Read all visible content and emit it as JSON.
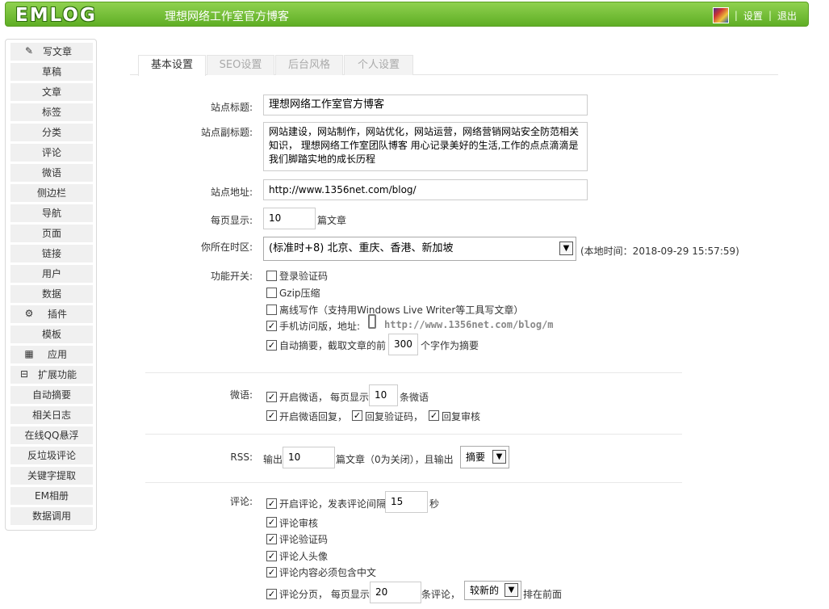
{
  "header": {
    "logo": "EMLOG",
    "site_title": "理想网络工作室官方博客",
    "settings_link": "设置",
    "logout_link": "退出",
    "sep": "|"
  },
  "sidebar": {
    "items": [
      {
        "label": "写文章",
        "icon": "pencil-icon"
      },
      {
        "label": "草稿"
      },
      {
        "label": "文章"
      },
      {
        "label": "标签"
      },
      {
        "label": "分类"
      },
      {
        "label": "评论"
      },
      {
        "label": "微语"
      },
      {
        "label": "侧边栏"
      },
      {
        "label": "导航"
      },
      {
        "label": "页面"
      },
      {
        "label": "链接"
      },
      {
        "label": "用户"
      },
      {
        "label": "数据"
      },
      {
        "label": "插件",
        "icon": "plugin-icon"
      },
      {
        "label": "模板"
      },
      {
        "label": "应用",
        "icon": "app-icon"
      },
      {
        "label": "扩展功能",
        "icon": "collapse-icon"
      },
      {
        "label": "自动摘要"
      },
      {
        "label": "相关日志"
      },
      {
        "label": "在线QQ悬浮"
      },
      {
        "label": "反垃圾评论"
      },
      {
        "label": "关键字提取"
      },
      {
        "label": "EM相册"
      },
      {
        "label": "数据调用"
      }
    ]
  },
  "tabs": [
    "基本设置",
    "SEO设置",
    "后台风格",
    "个人设置"
  ],
  "form": {
    "site_title_label": "站点标题:",
    "site_title_value": "理想网络工作室官方博客",
    "subtitle_label": "站点副标题:",
    "subtitle_value": "网站建设，网站制作，网站优化，网站运营，网络营销网站安全防范相关知识， 理想网络工作室团队博客    用心记录美好的生活,工作的点点滴滴是我们脚踏实地的成长历程",
    "url_label": "站点地址:",
    "url_value": "http://www.1356net.com/blog/",
    "per_page_label": "每页显示:",
    "per_page_value": "10",
    "per_page_unit": "篇文章",
    "timezone_label": "你所在时区:",
    "timezone_value": "(标准时+8) 北京、重庆、香港、新加坡",
    "local_time": "(本地时间：2018-09-29 15:57:59)",
    "features_label": "功能开关:",
    "login_captcha": "登录验证码",
    "gzip": "Gzip压缩",
    "offline_write": "离线写作（支持用Windows Live Writer等工具写文章）",
    "mobile": "手机访问版，地址:",
    "mobile_url": "http://www.1356net.com/blog/m",
    "auto_excerpt_pre": "自动摘要，截取文章的前",
    "auto_excerpt_value": "300",
    "auto_excerpt_post": "个字作为摘要",
    "twitter_label": "微语:",
    "twitter_enable": "开启微语，",
    "twitter_per_page_pre": "每页显示",
    "twitter_per_page_value": "10",
    "twitter_per_page_post": "条微语",
    "twitter_reply": "开启微语回复，",
    "twitter_reply_captcha": "回复验证码，",
    "twitter_reply_audit": "回复审核",
    "rss_label": "RSS:",
    "rss_pre": "输出",
    "rss_value": "10",
    "rss_mid": "篇文章（0为关闭），且输出",
    "rss_select": "摘要",
    "comment_label": "评论:",
    "comment_enable": "开启评论，发表评论间隔",
    "comment_interval": "15",
    "comment_interval_unit": "秒",
    "comment_audit": "评论审核",
    "comment_captcha": "评论验证码",
    "comment_avatar": "评论人头像",
    "comment_chinese": "评论内容必须包含中文",
    "comment_paging_pre": "评论分页，  每页显示",
    "comment_paging_value": "20",
    "comment_paging_mid": "条评论，",
    "comment_order": "较新的",
    "comment_order_post": "排在前面"
  },
  "checks": {
    "login_captcha": false,
    "gzip": false,
    "offline_write": false,
    "mobile": true,
    "auto_excerpt": true,
    "twitter_enable": true,
    "twitter_reply": true,
    "twitter_reply_captcha": true,
    "twitter_reply_audit": true,
    "comment_enable": true,
    "comment_audit": true,
    "comment_captcha": true,
    "comment_avatar": true,
    "comment_chinese": true,
    "comment_paging": true
  },
  "colors": {
    "header_green": "#6cbd2e",
    "sidebar_bg": "#f0f0f0"
  }
}
